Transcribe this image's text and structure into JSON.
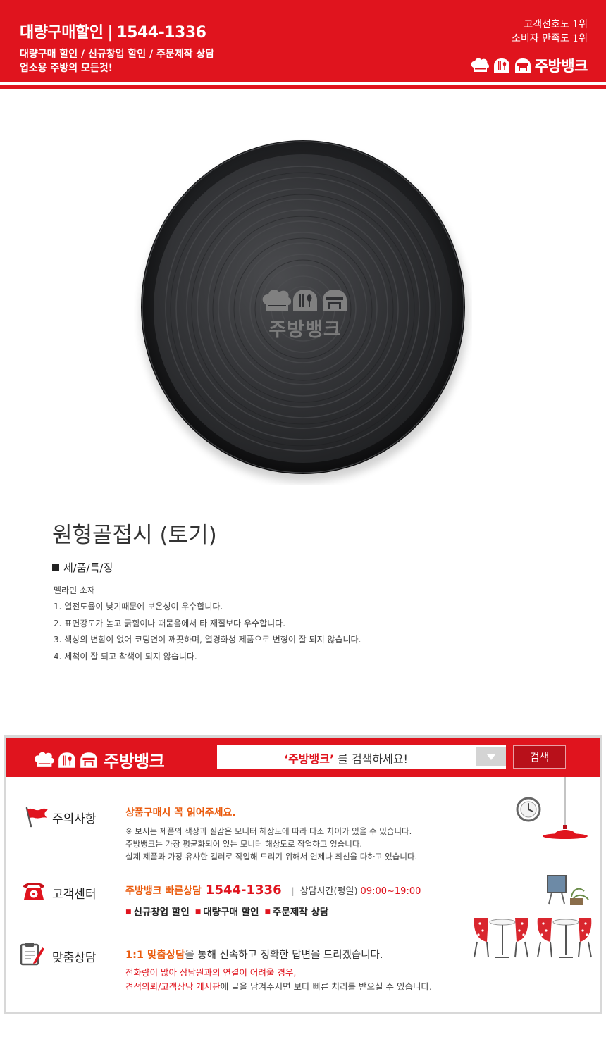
{
  "top_banner": {
    "title_main": "대량구매할인",
    "title_sep": "|",
    "phone": "1544-1336",
    "subtitle_1": "대량구매 할인 / 신규창업 할인 / 주문제작 상담",
    "subtitle_2": "업소용 주방의 모든것!",
    "rank_1": "고객선호도 1위",
    "rank_2": "소비자 만족도 1위",
    "logo_text": "주방뱅크"
  },
  "product": {
    "watermark": "주방뱅크",
    "name": "원형골접시 (토기)",
    "feature_heading": "제/품/특/징",
    "material": "멜라민 소재",
    "features": [
      "1. 열전도율이 낮기때문에 보온성이 우수합니다.",
      "2. 표면강도가 높고 긁힘이나 때묻음에서 타 재질보다 우수합니다.",
      "3. 색상의 변함이 없어 코팅면이 깨끗하며, 열경화성 제품으로 변형이 잘 되지 않습니다.",
      "4. 세척이 잘 되고 착색이 되지 않습니다."
    ]
  },
  "info_box": {
    "logo_text": "주방뱅크",
    "search": {
      "highlight": "‘주방뱅크’",
      "suffix": " 를 검색하세요!",
      "button": "검색"
    },
    "caution": {
      "title": "주의사항",
      "heading": "상품구매시 꼭 읽어주세요.",
      "lines": [
        "※ 보시는 제품의 색상과 질감은 모니터 해상도에 따라 다소 차이가 있을 수 있습니다.",
        "주방뱅크는 가장 평균화되어 있는 모니터  해상도로 작업하고 있습니다.",
        "실제 제품과 가장 유사한 컬러로 작업해 드리기 위해서 언제나 최선을 다하고 있습니다."
      ]
    },
    "customer_center": {
      "title": "고객센터",
      "quick_label": "주방뱅크 빠른상담",
      "phone": "1544-1336",
      "pipe": "|",
      "hours_label": "상담시간(평일)",
      "hours": "09:00~19:00",
      "services": [
        "신규창업 할인",
        "대량구매 할인",
        "주문제작 상담"
      ],
      "bullet": "■"
    },
    "consult": {
      "title": "맞춤상담",
      "line1_highlight": "1:1 맞춤상담",
      "line1_rest": "을 통해 신속하고 정확한 답변을 드리겠습니다.",
      "line2": "전화량이 많아 상담원과의 연결이 어려울 경우,",
      "line3_highlight": "견적의뢰/고객상담 게시판",
      "line3_rest": "에 글을 남겨주시면 보다 빠른 처리를 받으실 수 있습니다."
    }
  },
  "colors": {
    "brand_red": "#e0141e",
    "accent_orange": "#ea5a0c",
    "plate_dark": "#2a2b2d"
  }
}
